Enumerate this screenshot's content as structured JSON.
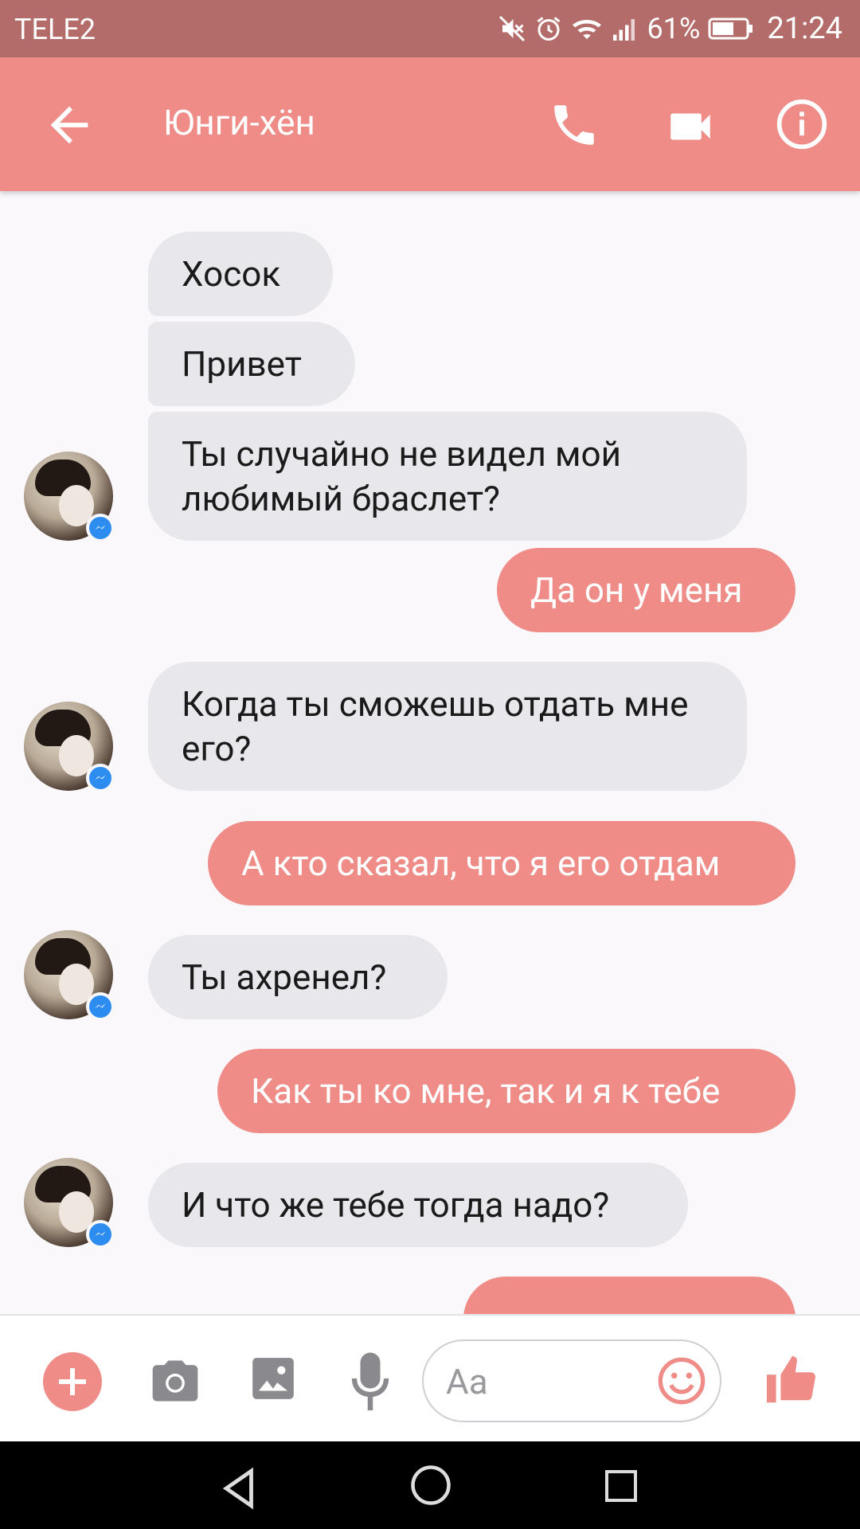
{
  "status_bar": {
    "carrier": "TELE2",
    "battery_percent": "61%",
    "time": "21:24",
    "icons": [
      "mute-icon",
      "alarm-icon",
      "wifi-icon",
      "signal-icon",
      "battery-icon"
    ]
  },
  "header": {
    "contact_name": "Юнги-хён",
    "icons": [
      "back-arrow-icon",
      "phone-icon",
      "video-camera-icon",
      "info-icon"
    ]
  },
  "messages": [
    {
      "from": "them",
      "text": "Хосок"
    },
    {
      "from": "them",
      "text": "Привет"
    },
    {
      "from": "them",
      "text": "Ты случайно не видел мой любимый браслет?"
    },
    {
      "from": "me",
      "text": "Да он у меня"
    },
    {
      "from": "them",
      "text": "Когда ты сможешь отдать мне его?"
    },
    {
      "from": "me",
      "text": "А кто сказал, что я его отдам"
    },
    {
      "from": "them",
      "text": "Ты ахренел?"
    },
    {
      "from": "me",
      "text": "Как ты ко мне, так и я к тебе"
    },
    {
      "from": "them",
      "text": "И что же тебе тогда надо?"
    },
    {
      "from": "me",
      "text": ""
    }
  ],
  "composer": {
    "placeholder": "Aa",
    "value": "",
    "icons": [
      "plus-icon",
      "camera-icon",
      "image-icon",
      "microphone-icon",
      "emoji-icon",
      "thumbs-up-icon"
    ]
  },
  "colors": {
    "accent": "#ef8c87",
    "status_bar": "#b46c6a",
    "incoming_bubble": "#e8e7ec",
    "background": "#faf8fb"
  }
}
